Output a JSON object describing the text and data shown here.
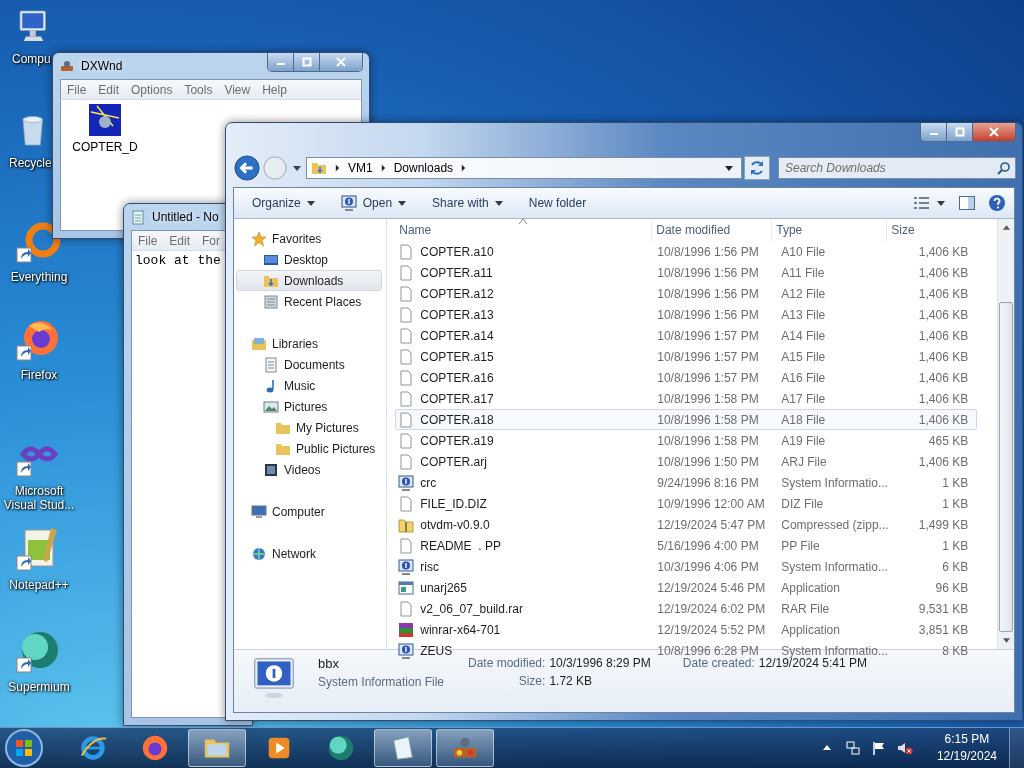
{
  "desktop_icons": [
    {
      "label": "Compu",
      "kind": "computer",
      "shortcut": false
    },
    {
      "label": "Recycle",
      "kind": "recycle",
      "shortcut": false
    },
    {
      "label": "Everything",
      "kind": "everything",
      "shortcut": true
    },
    {
      "label": "Firefox",
      "kind": "firefox",
      "shortcut": true
    },
    {
      "label": "Microsoft Visual Stud...",
      "kind": "vstudio",
      "shortcut": true
    },
    {
      "label": "Notepad++",
      "kind": "notepadpp",
      "shortcut": true
    },
    {
      "label": "Supermium",
      "kind": "supermium",
      "shortcut": true
    }
  ],
  "dxwnd": {
    "title": "DXWnd",
    "menu": [
      "File",
      "Edit",
      "Options",
      "Tools",
      "View",
      "Help"
    ],
    "items": [
      {
        "label": "COPTER_D"
      }
    ]
  },
  "notepad": {
    "title": "Untitled - No",
    "menu": [
      "File",
      "Edit",
      "For"
    ],
    "text": "look at the"
  },
  "explorer": {
    "breadcrumb": [
      "VM1",
      "Downloads"
    ],
    "search_placeholder": "Search Downloads",
    "toolbar": [
      {
        "label": "Organize",
        "kind": "menu"
      },
      {
        "label": "Open",
        "kind": "open"
      },
      {
        "label": "Share with",
        "kind": "menu"
      },
      {
        "label": "New folder",
        "kind": "plain"
      }
    ],
    "nav": [
      {
        "label": "Favorites",
        "kind": "favorites",
        "selected": false,
        "children": [
          {
            "label": "Desktop",
            "kind": "desktop",
            "selected": false
          },
          {
            "label": "Downloads",
            "kind": "downloads",
            "selected": true
          },
          {
            "label": "Recent Places",
            "kind": "recent",
            "selected": false
          }
        ]
      },
      {
        "label": "Libraries",
        "kind": "libraries",
        "selected": false,
        "children": [
          {
            "label": "Documents",
            "kind": "documents",
            "selected": false
          },
          {
            "label": "Music",
            "kind": "music",
            "selected": false
          },
          {
            "label": "Pictures",
            "kind": "pictures",
            "selected": false,
            "children": [
              {
                "label": "My Pictures",
                "kind": "folder",
                "selected": false
              },
              {
                "label": "Public Pictures",
                "kind": "folder",
                "selected": false
              }
            ]
          },
          {
            "label": "Videos",
            "kind": "videos",
            "selected": false
          }
        ]
      },
      {
        "label": "Computer",
        "kind": "computer",
        "selected": false
      },
      {
        "label": "Network",
        "kind": "network",
        "selected": false
      }
    ],
    "columns": [
      "Name",
      "Date modified",
      "Type",
      "Size"
    ],
    "files": [
      {
        "name": "COPTER.a10",
        "date": "10/8/1996 1:56 PM",
        "type": "A10 File",
        "size": "1,406 KB",
        "kind": "file",
        "selected": false
      },
      {
        "name": "COPTER.a11",
        "date": "10/8/1996 1:56 PM",
        "type": "A11 File",
        "size": "1,406 KB",
        "kind": "file",
        "selected": false
      },
      {
        "name": "COPTER.a12",
        "date": "10/8/1996 1:56 PM",
        "type": "A12 File",
        "size": "1,406 KB",
        "kind": "file",
        "selected": false
      },
      {
        "name": "COPTER.a13",
        "date": "10/8/1996 1:56 PM",
        "type": "A13 File",
        "size": "1,406 KB",
        "kind": "file",
        "selected": false
      },
      {
        "name": "COPTER.a14",
        "date": "10/8/1996 1:57 PM",
        "type": "A14 File",
        "size": "1,406 KB",
        "kind": "file",
        "selected": false
      },
      {
        "name": "COPTER.a15",
        "date": "10/8/1996 1:57 PM",
        "type": "A15 File",
        "size": "1,406 KB",
        "kind": "file",
        "selected": false
      },
      {
        "name": "COPTER.a16",
        "date": "10/8/1996 1:57 PM",
        "type": "A16 File",
        "size": "1,406 KB",
        "kind": "file",
        "selected": false
      },
      {
        "name": "COPTER.a17",
        "date": "10/8/1996 1:58 PM",
        "type": "A17 File",
        "size": "1,406 KB",
        "kind": "file",
        "selected": false
      },
      {
        "name": "COPTER.a18",
        "date": "10/8/1996 1:58 PM",
        "type": "A18 File",
        "size": "1,406 KB",
        "kind": "file",
        "selected": true
      },
      {
        "name": "COPTER.a19",
        "date": "10/8/1996 1:58 PM",
        "type": "A19 File",
        "size": "465 KB",
        "kind": "file",
        "selected": false
      },
      {
        "name": "COPTER.arj",
        "date": "10/8/1996 1:50 PM",
        "type": "ARJ File",
        "size": "1,406 KB",
        "kind": "file",
        "selected": false
      },
      {
        "name": "crc",
        "date": "9/24/1996 8:16 PM",
        "type": "System Informatio...",
        "size": "1 KB",
        "kind": "sysinfo",
        "selected": false
      },
      {
        "name": "FILE_ID.DIZ",
        "date": "10/9/1996 12:00 AM",
        "type": "DIZ File",
        "size": "1 KB",
        "kind": "file",
        "selected": false
      },
      {
        "name": "otvdm-v0.9.0",
        "date": "12/19/2024 5:47 PM",
        "type": "Compressed (zipp...",
        "size": "1,499 KB",
        "kind": "zip",
        "selected": false
      },
      {
        "name": "README  . PP",
        "date": "5/16/1996 4:00 PM",
        "type": "PP File",
        "size": "1 KB",
        "kind": "file",
        "selected": false
      },
      {
        "name": "risc",
        "date": "10/3/1996 4:06 PM",
        "type": "System Informatio...",
        "size": "6 KB",
        "kind": "sysinfo",
        "selected": false
      },
      {
        "name": "unarj265",
        "date": "12/19/2024 5:46 PM",
        "type": "Application",
        "size": "96 KB",
        "kind": "app",
        "selected": false
      },
      {
        "name": "v2_06_07_build.rar",
        "date": "12/19/2024 6:02 PM",
        "type": "RAR File",
        "size": "9,531 KB",
        "kind": "file",
        "selected": false
      },
      {
        "name": "winrar-x64-701",
        "date": "12/19/2024 5:52 PM",
        "type": "Application",
        "size": "3,851 KB",
        "kind": "winrar",
        "selected": false
      },
      {
        "name": "ZEUS",
        "date": "10/8/1996 6:28 PM",
        "type": "System Informatio...",
        "size": "8 KB",
        "kind": "sysinfo",
        "selected": false
      }
    ],
    "details": {
      "name": "bbx",
      "type": "System Information File",
      "fields": [
        {
          "label": "Date modified:",
          "value": "10/3/1996 8:29 PM"
        },
        {
          "label": "Date created:",
          "value": "12/19/2024 5:41 PM"
        },
        {
          "label": "Size:",
          "value": "1.72 KB"
        }
      ]
    }
  },
  "taskbar": {
    "apps": [
      {
        "kind": "ie",
        "active": false
      },
      {
        "kind": "firefox",
        "active": false
      },
      {
        "kind": "explorer",
        "active": true
      },
      {
        "kind": "media",
        "active": false
      },
      {
        "kind": "supermium",
        "active": false
      },
      {
        "kind": "notepad",
        "active": true
      },
      {
        "kind": "dxwnd",
        "active": true
      }
    ],
    "time": "6:15 PM",
    "date": "12/19/2024"
  }
}
